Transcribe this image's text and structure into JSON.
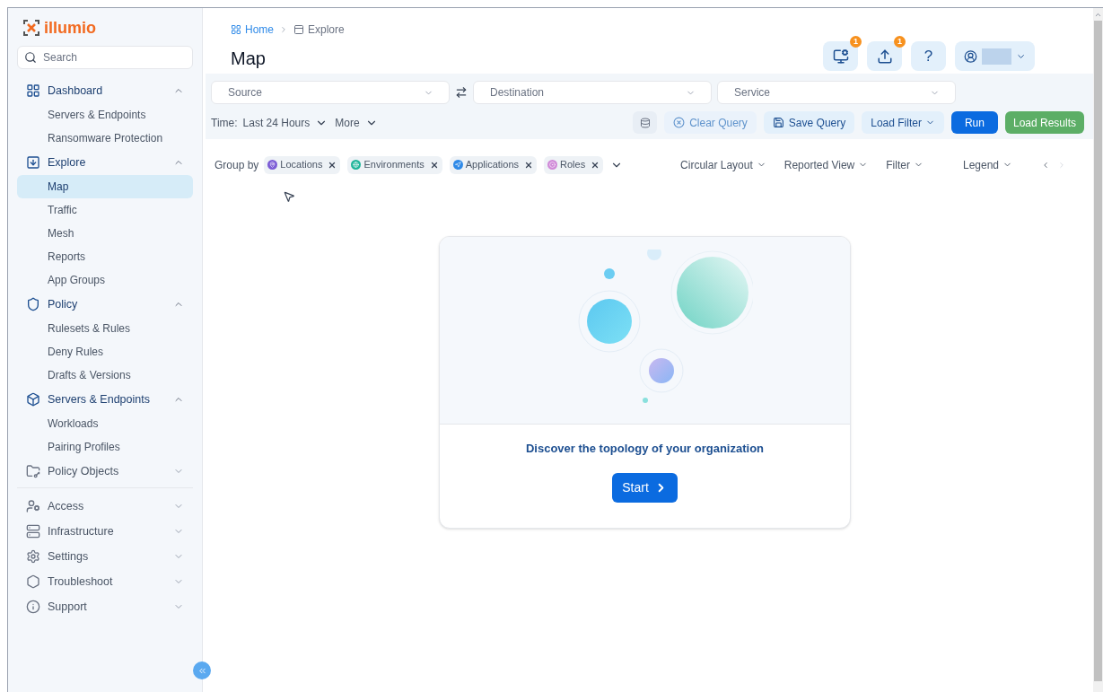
{
  "brand": {
    "name": "illumio"
  },
  "search": {
    "placeholder": "Search"
  },
  "sidebar": {
    "sections": [
      {
        "items": [
          {
            "label": "Dashboard",
            "expanded": true,
            "children": [
              {
                "label": "Servers & Endpoints",
                "selected": false
              },
              {
                "label": "Ransomware Protection",
                "selected": false
              }
            ]
          },
          {
            "label": "Explore",
            "expanded": true,
            "children": [
              {
                "label": "Map",
                "selected": true
              },
              {
                "label": "Traffic",
                "selected": false
              },
              {
                "label": "Mesh",
                "selected": false
              },
              {
                "label": "Reports",
                "selected": false
              },
              {
                "label": "App Groups",
                "selected": false
              }
            ]
          },
          {
            "label": "Policy",
            "expanded": true,
            "children": [
              {
                "label": "Rulesets & Rules",
                "selected": false
              },
              {
                "label": "Deny Rules",
                "selected": false
              },
              {
                "label": "Drafts & Versions",
                "selected": false
              }
            ]
          },
          {
            "label": "Servers & Endpoints",
            "expanded": true,
            "children": [
              {
                "label": "Workloads",
                "selected": false
              },
              {
                "label": "Pairing Profiles",
                "selected": false
              }
            ]
          },
          {
            "label": "Policy Objects",
            "expanded": false
          }
        ]
      },
      {
        "items": [
          {
            "label": "Access",
            "expanded": false
          },
          {
            "label": "Infrastructure",
            "expanded": false
          },
          {
            "label": "Settings",
            "expanded": false
          },
          {
            "label": "Troubleshoot",
            "expanded": false
          },
          {
            "label": "Support",
            "expanded": false
          }
        ]
      }
    ]
  },
  "breadcrumb": [
    {
      "label": "Home"
    },
    {
      "label": "Explore"
    }
  ],
  "page_title": "Map",
  "header_buttons": [
    {
      "kind": "monitor",
      "badge": "1"
    },
    {
      "kind": "upload",
      "badge": "1"
    },
    {
      "kind": "help",
      "text": "?"
    },
    {
      "kind": "user"
    }
  ],
  "query": {
    "source": {
      "placeholder": "Source"
    },
    "destination": {
      "placeholder": "Destination"
    },
    "service": {
      "placeholder": "Service"
    },
    "time_label": "Time:",
    "time_value": "Last 24 Hours",
    "more": "More",
    "actions": [
      {
        "kind": "icon",
        "disabled": false
      },
      {
        "kind": "clear",
        "label": "Clear Query",
        "disabled": true
      },
      {
        "kind": "save",
        "label": "Save Query",
        "disabled": false
      },
      {
        "kind": "dropdown",
        "label": "Load Filter",
        "disabled": false
      },
      {
        "kind": "primary",
        "label": "Run",
        "disabled": false
      },
      {
        "kind": "success",
        "label": "Load Results",
        "disabled": true
      }
    ]
  },
  "group_by": {
    "label": "Group by",
    "chips": [
      {
        "label": "Locations",
        "color": "#7c5cd6"
      },
      {
        "label": "Environments",
        "color": "#1fb59a"
      },
      {
        "label": "Applications",
        "color": "#2f8ae8"
      },
      {
        "label": "Roles",
        "color": "#d08ad8"
      }
    ]
  },
  "view_controls": [
    {
      "label": "Circular Layout"
    },
    {
      "label": "Reported View"
    },
    {
      "label": "Filter"
    },
    {
      "label": "Legend"
    }
  ],
  "empty_state": {
    "message": "Discover the topology of your organization",
    "button": "Start"
  }
}
